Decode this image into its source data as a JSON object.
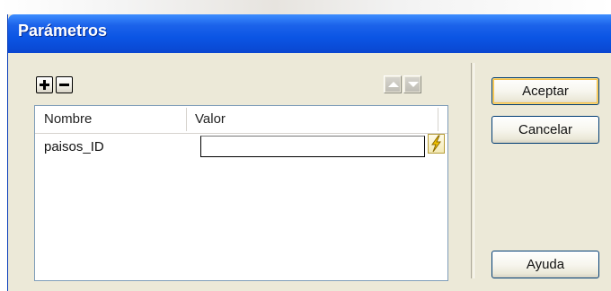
{
  "window": {
    "title": "Parámetros"
  },
  "toolbar": {
    "add_icon": "plus-icon",
    "remove_icon": "minus-icon",
    "move_up_icon": "triangle-up-icon",
    "move_down_icon": "triangle-down-icon"
  },
  "table": {
    "columns": [
      "Nombre",
      "Valor"
    ],
    "rows": [
      {
        "nombre": "paisos_ID",
        "valor": ""
      }
    ],
    "dynamic_data_icon": "lightning-bolt-icon"
  },
  "buttons": {
    "accept": "Aceptar",
    "cancel": "Cancelar",
    "help": "Ayuda"
  },
  "colors": {
    "titlebar": "#0b55e4",
    "dialog_bg": "#ece9d8",
    "default_button_highlight": "#f5bf45"
  }
}
